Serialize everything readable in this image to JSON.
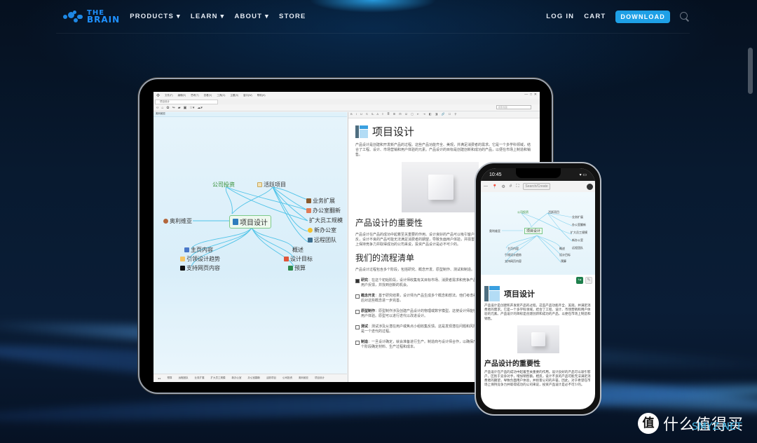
{
  "nav": {
    "logo_line1": "THE",
    "logo_line2": "BRAIN",
    "links": [
      "PRODUCTS ▾",
      "LEARN ▾",
      "ABOUT ▾",
      "STORE"
    ],
    "login": "LOG IN",
    "cart": "CART",
    "download": "DOWNLOAD"
  },
  "colors": {
    "accent": "#1ea0e6",
    "background": "#061224",
    "center_node_border": "#7cc98a",
    "link_lines": "#4fc3e8"
  },
  "tablet": {
    "menu": [
      "文件(F)",
      "编辑(E)",
      "思考(T)",
      "查看(V)",
      "工具(O)",
      "主题(S)",
      "窗口(W)",
      "帮助(H)"
    ],
    "tab_label": "项目设计",
    "plex_header": "奥利维亚",
    "search_placeholder": "搜索/创建",
    "notes_toolbar": "B I U S S̶ A ≡ ≣ ⊞ ⊟ ☑ ◻ ⇤ ⇥ ◧ ◨ 🔗 ☐ ⚲",
    "nodes": {
      "center": "项目设计",
      "parents": [
        "公司投资",
        "活跃项目"
      ],
      "jump": "奥利维亚",
      "siblings": [
        "业务扩展",
        "办公室翻新",
        "扩大员工规模",
        "新办公室",
        "远程团队"
      ],
      "children_left": [
        "主页内容",
        "引领设计趋势",
        "支持网页内容"
      ],
      "children_right": [
        "概述",
        "设计目标",
        "预算"
      ]
    },
    "bottom_tabs": [
      "预算",
      "远程团队",
      "业务扩展",
      "扩大员工规模",
      "新办公室",
      "办公室翻新",
      "活跃项目",
      "公司投资",
      "奥利维亚",
      "项目设计"
    ],
    "notes": {
      "title": "项目设计",
      "intro": "产品设计是创建和开发新产品的过程。这些产品功能齐全、美观，并满足消费者的需求。它是一个多学科领域，结合了工程、设计、市场营销和用户体验的元素。产品设计的目标是创建创新和成功的产品，以便在市场上制造和销售。",
      "h2_importance": "产品设计的重要性",
      "importance": "产品设计在产品的成功中起着至关重要的作用。设计良好的产品可以吸引客户，区别于竞争对手，增加销售额。相反，设计不良的产品可能无法满足消费者的期望，导致负面用户体验，并损害公司的声誉。因此，对于希望在市场上保持竞争力并取得成功的公司来说，投资产品设计是必不可少的。",
      "h2_process": "我们的流程清单",
      "process_intro": "产品设计过程包含多个阶段，包括研究、概念开发、原型制作、测试和制造。",
      "checklist": [
        {
          "label": "研究",
          "text": "：在这个初始阶段，设计师收集有关目标市场、消费者需求和竞争产品的信息。他们进行市场调研，分析用户反馈，并找到创新的机会。",
          "checked": true
        },
        {
          "label": "概念开发",
          "text": "：基于研究结果，设计师为产品生成多个概念和想法。他们考虑美学、材料和制造可行性等因素。然后对这些概念进一步完善。",
          "checked": false
        },
        {
          "label": "原型制作",
          "text": "：原型制作涉及创建产品设计的物理或数字模型。这使设计师能够评估设计的功能性、人体工程学和用户体验。原型可以进行迭代以改进设计。",
          "checked": false
        },
        {
          "label": "测试",
          "text": "：测试涉及从潜在用户或焦点小组收集反馈。这是发现潜在问题和风险、可用性问题或改进的领域。测试是一个迭代的过程。",
          "checked": false
        },
        {
          "label": "制造",
          "text": "：一旦设计确定，就会准备进行生产。制造商与设计师合作，以确保产品可以在规模上可行地制造。在这个阶段确定材料、生产过程和成本。",
          "checked": false
        }
      ]
    }
  },
  "phone": {
    "time": "10:45",
    "status_icons": "▾ ▭",
    "search_placeholder": "Search/Create",
    "toolbar_icons": [
      "—",
      "📍",
      "⚙",
      "#",
      "⛶"
    ],
    "share_icon": "↪",
    "edit_icon": "✎",
    "notes_title": "项目设计",
    "intro": "产品设计是创建和开发新产品的过程。这些产品功能齐全、美观，并满足消费者的需求。它是一个多学科领域，结合了工程、设计、市场营销和用户体验的元素。产品设计的目标是创建创新和成功的产品，以便在市场上制造和销售。",
    "h2": "产品设计的重要性",
    "importance": "产品设计在产品的成功中起着至关重要的作用。设计良好的产品可以吸引客户，区别于竞争对手，增加销售额。相反，设计不良的产品可能无法满足消费者的期望，导致负面用户体验，并损害公司的声誉。因此，对于希望在市场上保持竞争力并取得成功的公司来说，投资产品设计是必不可少的。"
  },
  "watermark": {
    "badge": "值",
    "text": "什么值得买",
    "sub": "SMYZ.NET"
  }
}
